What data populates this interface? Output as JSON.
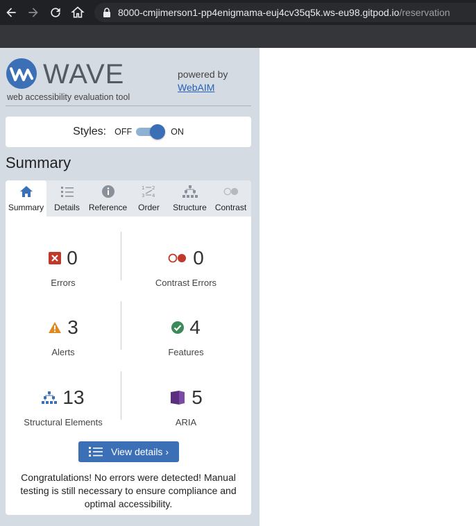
{
  "browser": {
    "url_host": "8000-cmjimerson1-pp4enigmama-euj4cv35q5k.ws-eu98.gitpod.io",
    "url_path": "/reservation"
  },
  "wave": {
    "brand": "WAVE",
    "tagline": "web accessibility evaluation tool",
    "powered_by": "powered by",
    "webaim_link": "WebAIM",
    "styles_label": "Styles:",
    "styles_off": "OFF",
    "styles_on": "ON",
    "styles_enabled": true,
    "section_title": "Summary",
    "tabs": [
      {
        "label": "Summary",
        "icon": "home-icon",
        "active": true
      },
      {
        "label": "Details",
        "icon": "list-icon",
        "active": false
      },
      {
        "label": "Reference",
        "icon": "info-icon",
        "active": false
      },
      {
        "label": "Order",
        "icon": "order-icon",
        "active": false
      },
      {
        "label": "Structure",
        "icon": "structure-icon",
        "active": false
      },
      {
        "label": "Contrast",
        "icon": "contrast-icon",
        "active": false
      }
    ],
    "stats": {
      "errors": {
        "count": "0",
        "label": "Errors",
        "icon": "error-icon"
      },
      "contrast_errors": {
        "count": "0",
        "label": "Contrast Errors",
        "icon": "contrast-error-icon"
      },
      "alerts": {
        "count": "3",
        "label": "Alerts",
        "icon": "alert-icon"
      },
      "features": {
        "count": "4",
        "label": "Features",
        "icon": "feature-icon"
      },
      "structural": {
        "count": "13",
        "label": "Structural Elements",
        "icon": "structure-icon"
      },
      "aria": {
        "count": "5",
        "label": "ARIA",
        "icon": "aria-icon"
      }
    },
    "view_details": "View details ›",
    "congrats": "Congratulations! No errors were detected! Manual testing is still necessary to ensure compliance and optimal accessibility."
  },
  "colors": {
    "panel_bg": "#d5dbe2",
    "accent": "#3b6fb6",
    "error": "#c0392b",
    "alert": "#e08a1e",
    "feature": "#3c8a5a",
    "aria": "#5b2f80"
  }
}
